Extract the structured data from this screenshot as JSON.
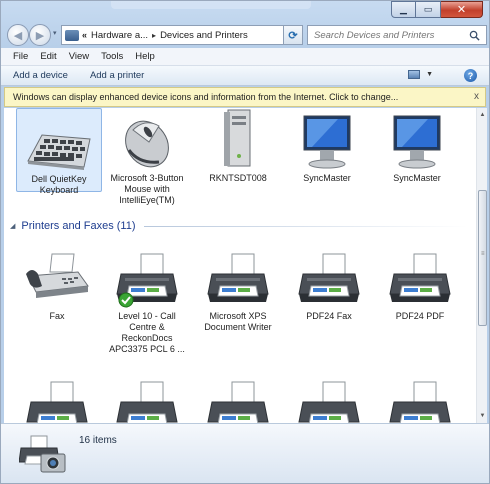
{
  "toolbar": {
    "breadcrumb": [
      "Hardware a...",
      "Devices and Printers"
    ],
    "recent_glyph": "▾",
    "chevrons": "«",
    "search_placeholder": "Search Devices and Printers"
  },
  "menu": [
    "File",
    "Edit",
    "View",
    "Tools",
    "Help"
  ],
  "commands": [
    "Add a device",
    "Add a printer"
  ],
  "infobar": {
    "message": "Windows can display enhanced device icons and information from the Internet. Click to change...",
    "close_glyph": "x"
  },
  "devices": [
    {
      "label": "Dell QuietKey Keyboard",
      "icon": "keyboard-icon",
      "selected": true
    },
    {
      "label": "Microsoft 3-Button Mouse with IntelliEye(TM)",
      "icon": "mouse-icon",
      "selected": false
    },
    {
      "label": "RKNTSDT008",
      "icon": "computer-tower-icon",
      "selected": false
    },
    {
      "label": "SyncMaster",
      "icon": "monitor-icon",
      "selected": false
    },
    {
      "label": "SyncMaster",
      "icon": "monitor-icon",
      "selected": false
    }
  ],
  "printers_group": {
    "title": "Printers and Faxes (11)",
    "collapse_glyph": "◢"
  },
  "printers": [
    {
      "label": "Fax",
      "icon": "fax-icon",
      "default": false
    },
    {
      "label": "Level 10 - Call Centre & ReckonDocs APC3375 PCL 6 ...",
      "icon": "printer-icon",
      "default": true
    },
    {
      "label": "Microsoft XPS Document Writer",
      "icon": "printer-icon",
      "default": false
    },
    {
      "label": "PDF24 Fax",
      "icon": "printer-icon",
      "default": false
    },
    {
      "label": "PDF24 PDF",
      "icon": "printer-icon",
      "default": false
    },
    {
      "label": "",
      "icon": "printer-icon",
      "default": false
    },
    {
      "label": "",
      "icon": "printer-icon",
      "default": false
    },
    {
      "label": "",
      "icon": "printer-icon",
      "default": false
    },
    {
      "label": "",
      "icon": "printer-icon",
      "default": false
    },
    {
      "label": "",
      "icon": "printer-icon",
      "default": false
    }
  ],
  "status": {
    "count": "16 items",
    "icon": "printer-camera-icon"
  },
  "colors": {
    "group_title": "#1e3d8f",
    "infobar_bg": "#fbf6c6",
    "selection_bg": "#dcebfc",
    "close_button": "#c2402c"
  }
}
